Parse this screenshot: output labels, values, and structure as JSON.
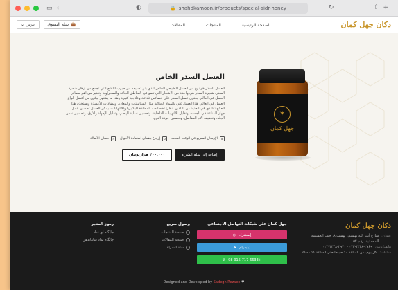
{
  "browser": {
    "url": "shahdkamoon.ir/products/special-sidr-honey",
    "back_icon": "chevron-left-icon",
    "tabs_icon": "sidebar-icon"
  },
  "header": {
    "logo": "دكان جهل كمان",
    "nav": [
      "الصفحة الرئيسية",
      "المنتجات",
      "المقالات"
    ],
    "cart_label": "سلة التسوق",
    "lang_label": "عربي"
  },
  "product": {
    "title": "العسل السدر الخاص",
    "description": "العسل السدر هو نوع من العسل الطبيعي الخاص الذي يتم تصنيعه من حبوب اللقاح التي تجمع من أزهار شجرة السدر. شجرة السدر هي واحدة من الأشجار التي تنمو في المناطق الجافة والصحراوية وتعتبر من أهم مصادر العسل في العالم. يحتوي عسل السدر على خصائص غذائية وعلاجية كثيرة وهذا ما يشتهر ليكون من أفضل أنواع العسل في العالم. هذا العسل غني بالمواد الغذائية مثل الفيتامينات والمعادن ومضادات الأكسدة ويستخدم هذا العلاج تقليدي في العديد من البلدان. نظرا لخصائصه المضادة للبكتيريا والالتهابات، يمكن العسل تحسين عمل جهاز المناعة في الجسم، وتقليل الالتهابات الداخلية، وتحسين عملية الهضم، وتقليل الإجهاد والأرق، وتحسين نفس الجلد، وتخفيف آلام المفاصل، وتحسين جودة النوم.",
    "features": [
      "الإرسال السريع في الوقت المحدد",
      "إرجاع بضمان استعادة الأموال",
      "ضمان الأصالة"
    ],
    "add_to_cart": "إضافة إلى سلة الشراء",
    "price": "۴۰۰,۰۰۰ هزارتومان",
    "jar_label": "جهل كمان"
  },
  "footer": {
    "logo": "دكان جهل كمان",
    "contact": [
      {
        "k": "عنوان:",
        "v": "شارع آيت الله بهشتي، بهشت ۸، جنب الحسينية المحمدية، رقم ۵۲"
      },
      {
        "k": "هاتف/ثابت:",
        "v": "۰۲۳-۳۳۴۸-۲۹۶۹ - ۰۲۳-۳۳۴۸-۲۹۷۰"
      },
      {
        "k": "ساعات:",
        "v": "كل يوم، من الساعة ۱۰ صباحا حتى الساعة ۱۱ مساء"
      }
    ],
    "social_heading": "جهل كمان على شبكات التواصل الاجتماعي",
    "social": [
      {
        "label": "إنستغرام",
        "icon": "instagram-icon",
        "color": "#d6336c"
      },
      {
        "label": "تيليغرام",
        "icon": "telegram-icon",
        "color": "#3b9bd9"
      },
      {
        "label": "+98-915-717-6633",
        "icon": "whatsapp-icon",
        "color": "#2fbf4a"
      }
    ],
    "links_heading": "وصول سريع",
    "links": [
      "صفحة المنتجات",
      "صفحة المقالات",
      "سلة الشراء"
    ],
    "codes_heading": "رموز المتجر",
    "codes": [
      "جايگاه اي نماد",
      "جايگاه نماد ساماندهي"
    ],
    "credit_prefix": "Designed and Developed by",
    "credit_brand": "Sadegh Rezaee",
    "credit_icon": "heart-icon"
  }
}
